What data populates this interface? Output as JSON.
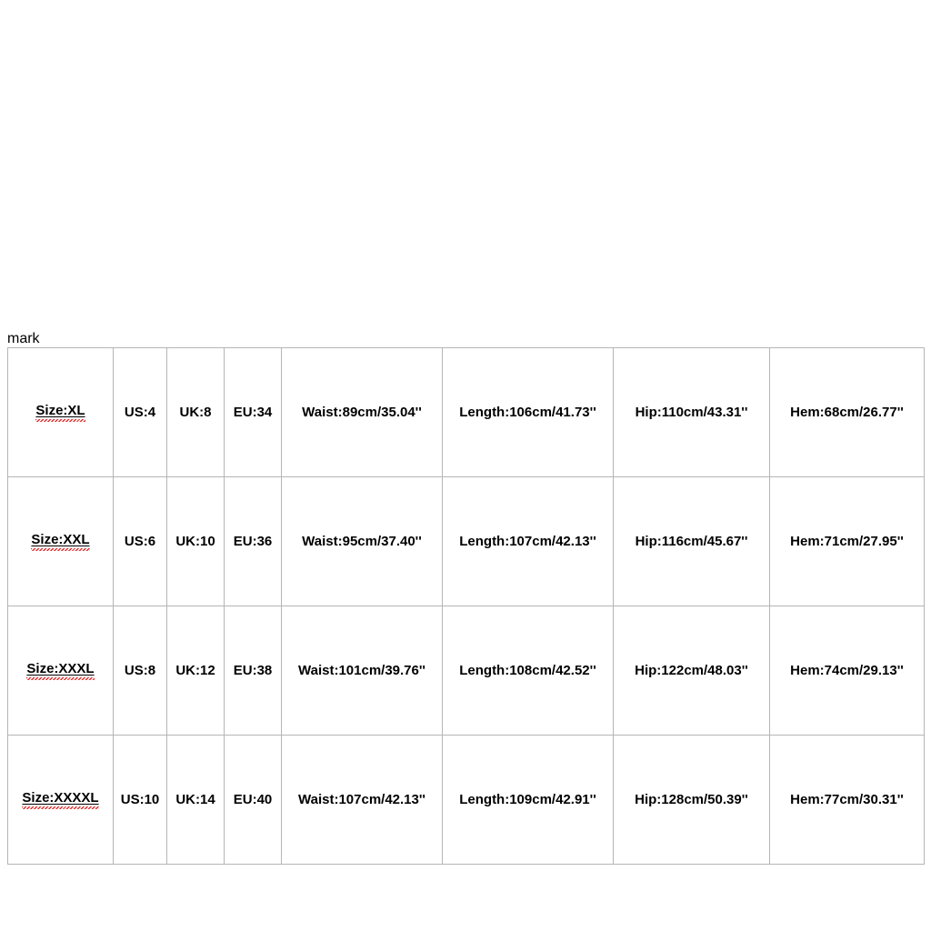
{
  "table": {
    "rows": [
      {
        "size": "Size:XL",
        "us": "US:4",
        "uk": "UK:8",
        "eu": "EU:34",
        "waist": "Waist:89cm/35.04''",
        "length": "Length:106cm/41.73''",
        "hip": "Hip:110cm/43.31''",
        "hem": "Hem:68cm/26.77''"
      },
      {
        "size": "Size:XXL",
        "us": "US:6",
        "uk": "UK:10",
        "eu": "EU:36",
        "waist": "Waist:95cm/37.40''",
        "length": "Length:107cm/42.13''",
        "hip": "Hip:116cm/45.67''",
        "hem": "Hem:71cm/27.95''"
      },
      {
        "size": "Size:XXXL",
        "us": "US:8",
        "uk": "UK:12",
        "eu": "EU:38",
        "waist": "Waist:101cm/39.76''",
        "length": "Length:108cm/42.52''",
        "hip": "Hip:122cm/48.03''",
        "hem": "Hem:74cm/29.13''"
      },
      {
        "size": "Size:XXXXL",
        "us": "US:10",
        "uk": "UK:14",
        "eu": "EU:40",
        "waist": "Waist:107cm/42.13''",
        "length": "Length:109cm/42.91''",
        "hip": "Hip:128cm/50.39''",
        "hem": "Hem:77cm/30.31''"
      }
    ]
  }
}
